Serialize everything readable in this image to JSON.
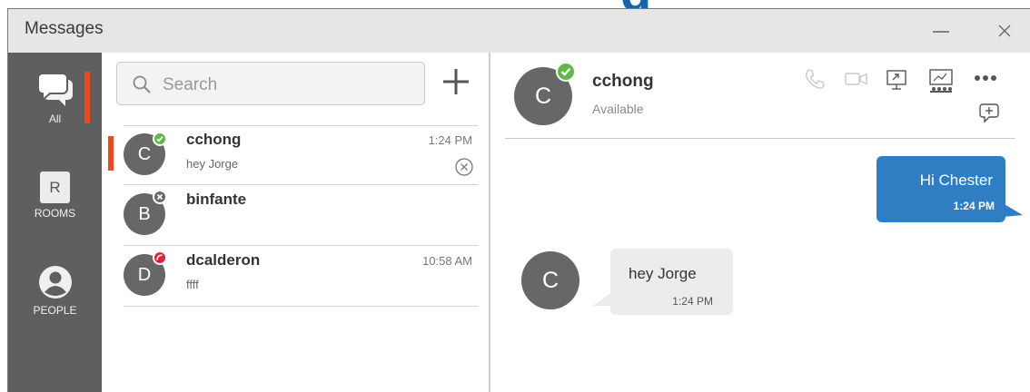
{
  "window": {
    "title": "Messages"
  },
  "rail": {
    "items": [
      {
        "label": "All",
        "icon": "chat-bubbles-icon"
      },
      {
        "label": "ROOMS",
        "icon": "rooms-icon",
        "glyph": "R"
      },
      {
        "label": "PEOPLE",
        "icon": "person-icon"
      }
    ]
  },
  "search": {
    "placeholder": "Search"
  },
  "conversations": [
    {
      "avatar": "C",
      "name": "cchong",
      "preview": "hey Jorge",
      "time": "1:24 PM",
      "status": "available"
    },
    {
      "avatar": "B",
      "name": "binfante",
      "preview": "",
      "time": "",
      "status": "offline"
    },
    {
      "avatar": "D",
      "name": "dcalderon",
      "preview": "ffff",
      "time": "10:58 AM",
      "status": "busy"
    }
  ],
  "chat": {
    "contact": {
      "avatar": "C",
      "name": "cchong",
      "status_text": "Available"
    },
    "messages": [
      {
        "direction": "outgoing",
        "text": "Hi Chester",
        "time": "1:24 PM"
      },
      {
        "direction": "incoming",
        "avatar": "C",
        "text": "hey Jorge",
        "time": "1:24 PM"
      }
    ]
  },
  "colors": {
    "accent": "#f04a1c",
    "rail_bg": "#5f5f5f",
    "outgoing_bubble": "#2f7ec3",
    "incoming_bubble": "#ececec",
    "available": "#5fb84a",
    "busy": "#e0243a",
    "offline": "#6a6a6a",
    "background_text": "#1565a8"
  }
}
